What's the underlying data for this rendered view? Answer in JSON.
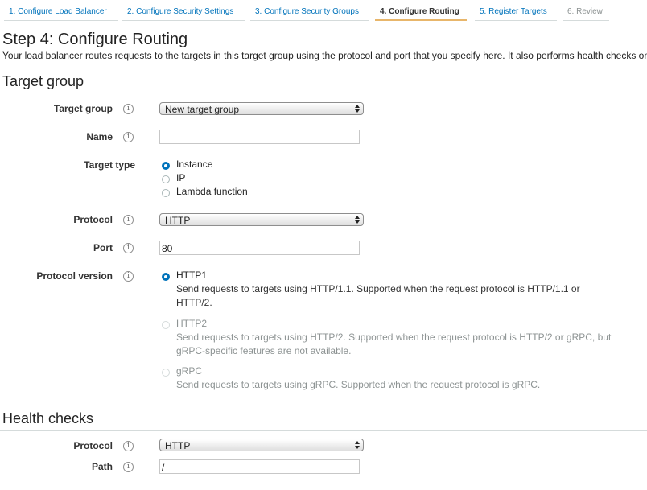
{
  "wizard": {
    "tabs": [
      {
        "label": "1. Configure Load Balancer"
      },
      {
        "label": "2. Configure Security Settings"
      },
      {
        "label": "3. Configure Security Groups"
      },
      {
        "label": "4. Configure Routing"
      },
      {
        "label": "5. Register Targets"
      },
      {
        "label": "6. Review"
      }
    ],
    "active_index": 3
  },
  "page": {
    "title": "Step 4: Configure Routing",
    "intro": "Your load balancer routes requests to the targets in this target group using the protocol and port that you specify here. It also performs health checks on"
  },
  "target_group": {
    "heading": "Target group",
    "target_group_label": "Target group",
    "target_group_value": "New target group",
    "name_label": "Name",
    "name_value": "",
    "target_type_label": "Target type",
    "target_type_options": [
      "Instance",
      "IP",
      "Lambda function"
    ],
    "target_type_selected": "Instance",
    "protocol_label": "Protocol",
    "protocol_value": "HTTP",
    "port_label": "Port",
    "port_value": "80",
    "protocol_version_label": "Protocol version",
    "protocol_version_options": [
      {
        "label": "HTTP1",
        "desc_line1": "Send requests to targets using HTTP/1.1. Supported when the request protocol is HTTP/1.1 or",
        "desc_line2": "HTTP/2.",
        "enabled": true
      },
      {
        "label": "HTTP2",
        "desc_line1": "Send requests to targets using HTTP/2. Supported when the request protocol is HTTP/2 or gRPC, but",
        "desc_line2": "gRPC-specific features are not available.",
        "enabled": false
      },
      {
        "label": "gRPC",
        "desc_line1": "Send requests to targets using gRPC. Supported when the request protocol is gRPC.",
        "desc_line2": "",
        "enabled": false
      }
    ],
    "protocol_version_selected": "HTTP1"
  },
  "health_checks": {
    "heading": "Health checks",
    "protocol_label": "Protocol",
    "protocol_value": "HTTP",
    "path_label": "Path",
    "path_value": "/"
  },
  "icons": {
    "info": "i",
    "info_icon_name": "info-icon",
    "select_arrows_name": "updown-arrows-icon"
  },
  "colors": {
    "link": "#0073bb",
    "active_tab_underline": "#e8b66b",
    "radio_selected": "#0073bb",
    "muted_text": "#8d9393"
  }
}
